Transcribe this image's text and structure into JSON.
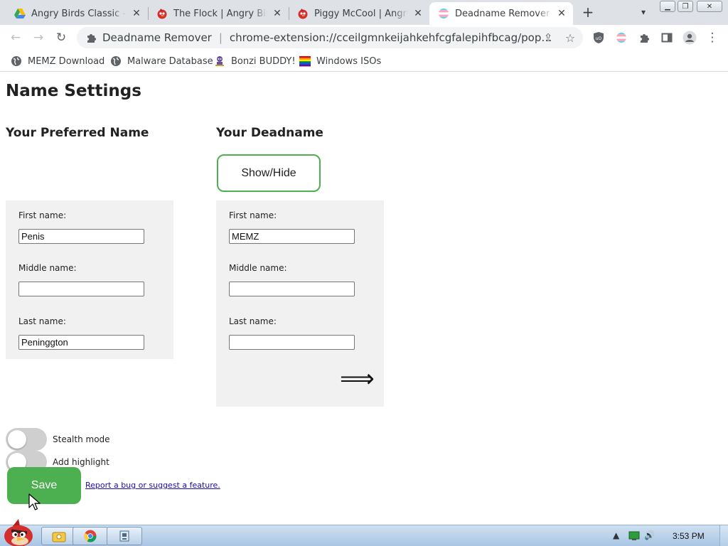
{
  "browser": {
    "tabs": [
      {
        "label": "Angry Birds Classic - Go",
        "favicon": "google-drive-icon",
        "active": false
      },
      {
        "label": "The Flock | Angry Birds",
        "favicon": "red-bird-icon",
        "active": false
      },
      {
        "label": "Piggy McCool | Angry B",
        "favicon": "red-bird-icon",
        "active": false
      },
      {
        "label": "Deadname Remover Op",
        "favicon": "trans-flag-icon",
        "active": true
      }
    ],
    "new_tab": "+",
    "address": {
      "extension_name": "Deadname Remover",
      "separator": "|",
      "url": "chrome-extension://cceilgmnkeijahkehfcgfalepihfbcag/popup/opt..."
    },
    "bookmarks": [
      {
        "label": "MEMZ Download",
        "icon": "globe-icon"
      },
      {
        "label": "Malware Database",
        "icon": "globe-icon"
      },
      {
        "label": "Bonzi BUDDY!",
        "icon": "bonzi-icon"
      },
      {
        "label": "Windows ISOs",
        "icon": "rainbow-flag-icon"
      }
    ]
  },
  "page": {
    "title": "Name Settings",
    "preferred": {
      "heading": "Your Preferred Name",
      "first_label": "First name:",
      "first_value": "Penis",
      "middle_label": "Middle name:",
      "middle_value": "",
      "last_label": "Last name:",
      "last_value": "Peninggton"
    },
    "deadname": {
      "heading": "Your Deadname",
      "show_hide": "Show/Hide",
      "first_label": "First name:",
      "first_value": "MEMZ",
      "middle_label": "Middle name:",
      "middle_value": "",
      "last_label": "Last name:",
      "last_value": "",
      "arrow": "⟹"
    },
    "options": {
      "stealth_label": "Stealth mode",
      "stealth_on": false,
      "highlight_label": "Add highlight",
      "highlight_on": false
    },
    "save_label": "Save",
    "report_link": "Report a bug or suggest a feature.",
    "accent_color": "#4caf50"
  },
  "taskbar": {
    "clock": "3:53 PM",
    "apps": [
      "explorer-icon",
      "chrome-icon",
      "app-icon"
    ]
  }
}
